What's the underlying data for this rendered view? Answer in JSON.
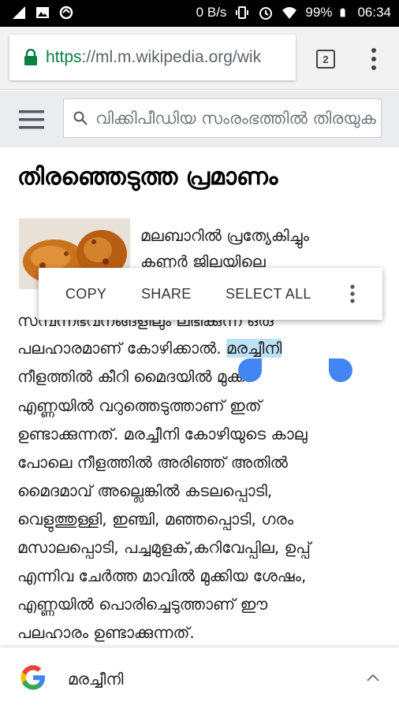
{
  "status_bar": {
    "network_speed": "0 B/s",
    "battery": "99%",
    "time": "06:34",
    "icons": [
      "signal-icon",
      "image-icon",
      "sync-icon",
      "vibrate-icon",
      "alarm-icon",
      "wifi-icon",
      "battery-icon"
    ]
  },
  "browser": {
    "url_scheme": "https",
    "url_rest": "://ml.m.wikipedia.org/wik",
    "tab_count": "2"
  },
  "wiki_header": {
    "search_placeholder": "വിക്കിപീഡിയ സംരംഭത്തിൽ തിരയുക"
  },
  "article": {
    "title": "തിരഞ്ഞെടുത്ത പ്രമാണം",
    "lines": [
      "മലബാറിൽ പ്രത്യേകിച്ചും",
      "കണ്ണൂർ ജില്ലയിലെ",
      "സമ്പന്നഭവനങ്ങളിലും ലഭിക്കുന്ന ഒരു",
      "പലഹാരമാണ് കോഴിക്കാൽ.",
      "മരച്ചീനി",
      "നീളത്തിൽ കീറി മൈദയിൽ മുക്കി",
      "എണ്ണയിൽ വറുത്തെടുത്താണ് ഇത്",
      "ഉണ്ടാക്കുന്നത്. മരച്ചീനി കോഴിയുടെ കാലു",
      "പോലെ നീളത്തിൽ അരിഞ്ഞ് അതിൽ",
      "മൈദമാവ് അല്ലെങ്കിൽ കടലപ്പൊടി,",
      "വെളുത്തുള്ളി, ഇഞ്ചി, മഞ്ഞപ്പൊടി, ഗരം",
      "മസാലപ്പൊടി, പച്ചമുളക്,കറിവേപ്പില, ഉപ്പ്",
      "എന്നിവ ചേർത്ത മാവിൽ മുക്കിയ ശേഷം,",
      "എണ്ണയിൽ പൊരിച്ചെടുത്താണ് ഈ",
      "പലഹാരം ഉണ്ടാക്കുന്നത്."
    ]
  },
  "text_selection_toolbar": {
    "copy": "COPY",
    "share": "SHARE",
    "select_all": "SELECT ALL"
  },
  "tap_to_search": {
    "query": "മരച്ചീനി"
  }
}
